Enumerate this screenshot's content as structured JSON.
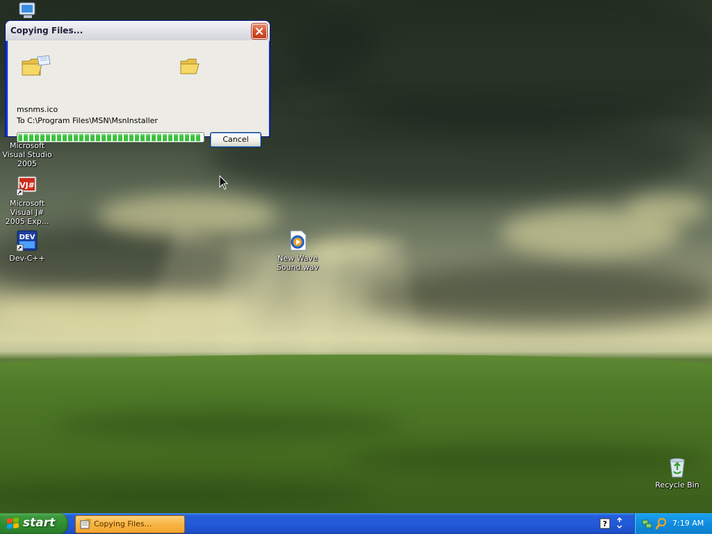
{
  "desktop": {
    "icons": [
      {
        "label": "Microsoft Visual Studio 2005"
      },
      {
        "label": "Microsoft Visual J# 2005 Exp..."
      },
      {
        "label": "Dev-C++"
      },
      {
        "label": "New Wave Sound.wav"
      },
      {
        "label": "Recycle Bin"
      }
    ]
  },
  "dialog": {
    "title": "Copying Files...",
    "file_name": "msnms.ico",
    "destination": "To C:\\Program Files\\MSN\\MsnInstaller",
    "progress_fraction": 0.99,
    "cancel_label": "Cancel"
  },
  "taskbar": {
    "start_label": "start",
    "task_label": "Copying Files...",
    "clock": "7:19 AM"
  },
  "colors": {
    "taskbar_blue": "#245edb",
    "start_green": "#3c9a3c",
    "tray_blue": "#0f8de0",
    "progress_green": "#3cc13c"
  },
  "icons": [
    "my-computer-icon",
    "visual-studio-icon",
    "vjsharp-icon",
    "devcpp-icon",
    "wav-file-icon",
    "recycle-bin-icon",
    "folder-icon",
    "close-icon",
    "windows-logo-icon",
    "help-icon",
    "network-icon",
    "search-icon",
    "mouse-cursor-icon"
  ]
}
